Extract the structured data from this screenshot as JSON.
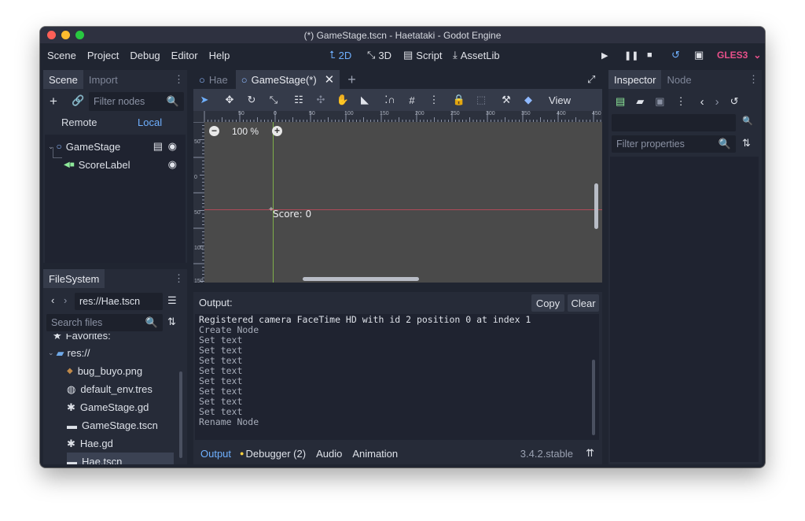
{
  "window_title": "(*) GameStage.tscn - Haetataki - Godot Engine",
  "menu": [
    "Scene",
    "Project",
    "Debug",
    "Editor",
    "Help"
  ],
  "workspaces": {
    "w2d": "2D",
    "w3d": "3D",
    "script": "Script",
    "assetlib": "AssetLib"
  },
  "renderer": "GLES3",
  "scene_dock": {
    "tab_scene": "Scene",
    "tab_import": "Import",
    "filter_placeholder": "Filter nodes",
    "remote": "Remote",
    "local": "Local",
    "tree": [
      {
        "label": "GameStage"
      },
      {
        "label": "ScoreLabel"
      }
    ]
  },
  "filesystem": {
    "tab": "FileSystem",
    "path": "res://Hae.tscn",
    "search_placeholder": "Search files",
    "favorites": "Favorites:",
    "root": "res://",
    "files": [
      {
        "name": "bug_buyo.png",
        "icon": "image-icon"
      },
      {
        "name": "default_env.tres",
        "icon": "globe-icon"
      },
      {
        "name": "GameStage.gd",
        "icon": "gear-icon"
      },
      {
        "name": "GameStage.tscn",
        "icon": "scene-icon"
      },
      {
        "name": "Hae.gd",
        "icon": "gear-icon"
      },
      {
        "name": "Hae.tscn",
        "icon": "scene-icon"
      }
    ]
  },
  "editor_tabs": [
    {
      "label": "Hae"
    },
    {
      "label": "GameStage(*)"
    }
  ],
  "viewport": {
    "zoom": "100 %",
    "view_label": "View",
    "canvas_text": "Score: 0",
    "ruler_ticks": [
      "50",
      "0",
      "50",
      "100",
      "150",
      "200",
      "250",
      "300",
      "350",
      "400",
      "450"
    ],
    "vruler_ticks": [
      "50",
      "0",
      "50",
      "100",
      "150"
    ]
  },
  "output": {
    "title": "Output:",
    "copy": "Copy",
    "clear": "Clear",
    "lines": [
      "Registered camera FaceTime HD with id 2 position 0 at index 1",
      "Create Node",
      "Set text",
      "Set text",
      "Set text",
      "Set text",
      "Set text",
      "Set text",
      "Set text",
      "Set text",
      "Rename Node"
    ],
    "bottom_tabs": {
      "output": "Output",
      "debugger": "Debugger (2)",
      "audio": "Audio",
      "animation": "Animation"
    },
    "version": "3.4.2.stable"
  },
  "inspector": {
    "tab_inspector": "Inspector",
    "tab_node": "Node",
    "filter_placeholder": "Filter properties"
  },
  "colors": {
    "accent": "#6fb0ff",
    "renderer": "#e8508a",
    "bg": "#202531",
    "panel": "#262b38"
  }
}
